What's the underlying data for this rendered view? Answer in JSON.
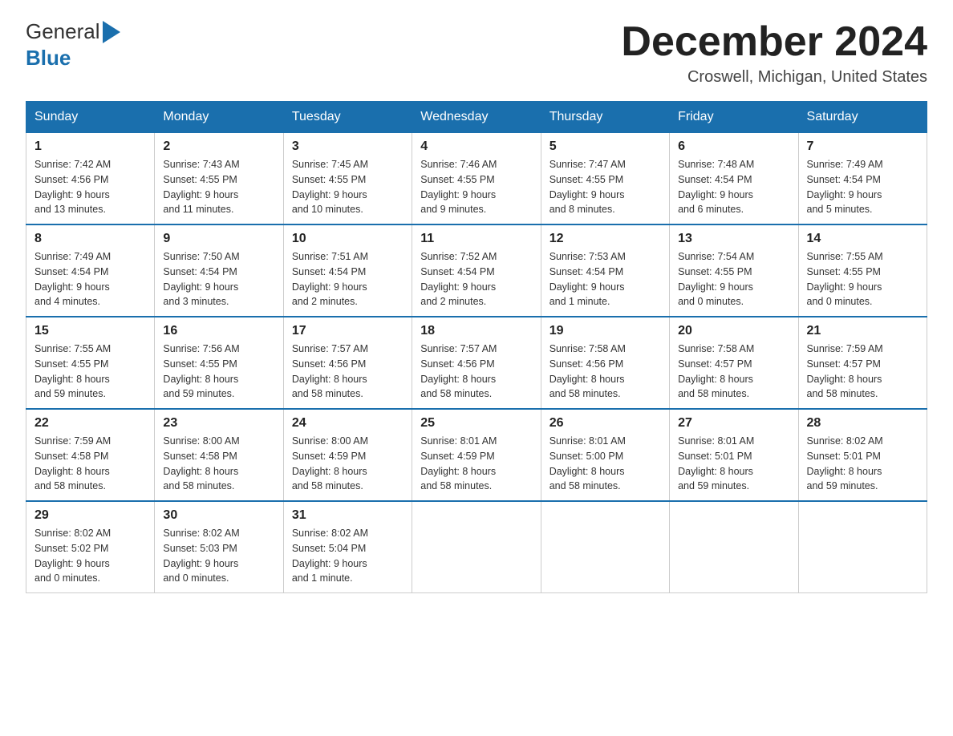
{
  "header": {
    "logo_general": "General",
    "logo_blue": "Blue",
    "title": "December 2024",
    "subtitle": "Croswell, Michigan, United States"
  },
  "weekdays": [
    "Sunday",
    "Monday",
    "Tuesday",
    "Wednesday",
    "Thursday",
    "Friday",
    "Saturday"
  ],
  "weeks": [
    [
      {
        "day": "1",
        "info": "Sunrise: 7:42 AM\nSunset: 4:56 PM\nDaylight: 9 hours\nand 13 minutes."
      },
      {
        "day": "2",
        "info": "Sunrise: 7:43 AM\nSunset: 4:55 PM\nDaylight: 9 hours\nand 11 minutes."
      },
      {
        "day": "3",
        "info": "Sunrise: 7:45 AM\nSunset: 4:55 PM\nDaylight: 9 hours\nand 10 minutes."
      },
      {
        "day": "4",
        "info": "Sunrise: 7:46 AM\nSunset: 4:55 PM\nDaylight: 9 hours\nand 9 minutes."
      },
      {
        "day": "5",
        "info": "Sunrise: 7:47 AM\nSunset: 4:55 PM\nDaylight: 9 hours\nand 8 minutes."
      },
      {
        "day": "6",
        "info": "Sunrise: 7:48 AM\nSunset: 4:54 PM\nDaylight: 9 hours\nand 6 minutes."
      },
      {
        "day": "7",
        "info": "Sunrise: 7:49 AM\nSunset: 4:54 PM\nDaylight: 9 hours\nand 5 minutes."
      }
    ],
    [
      {
        "day": "8",
        "info": "Sunrise: 7:49 AM\nSunset: 4:54 PM\nDaylight: 9 hours\nand 4 minutes."
      },
      {
        "day": "9",
        "info": "Sunrise: 7:50 AM\nSunset: 4:54 PM\nDaylight: 9 hours\nand 3 minutes."
      },
      {
        "day": "10",
        "info": "Sunrise: 7:51 AM\nSunset: 4:54 PM\nDaylight: 9 hours\nand 2 minutes."
      },
      {
        "day": "11",
        "info": "Sunrise: 7:52 AM\nSunset: 4:54 PM\nDaylight: 9 hours\nand 2 minutes."
      },
      {
        "day": "12",
        "info": "Sunrise: 7:53 AM\nSunset: 4:54 PM\nDaylight: 9 hours\nand 1 minute."
      },
      {
        "day": "13",
        "info": "Sunrise: 7:54 AM\nSunset: 4:55 PM\nDaylight: 9 hours\nand 0 minutes."
      },
      {
        "day": "14",
        "info": "Sunrise: 7:55 AM\nSunset: 4:55 PM\nDaylight: 9 hours\nand 0 minutes."
      }
    ],
    [
      {
        "day": "15",
        "info": "Sunrise: 7:55 AM\nSunset: 4:55 PM\nDaylight: 8 hours\nand 59 minutes."
      },
      {
        "day": "16",
        "info": "Sunrise: 7:56 AM\nSunset: 4:55 PM\nDaylight: 8 hours\nand 59 minutes."
      },
      {
        "day": "17",
        "info": "Sunrise: 7:57 AM\nSunset: 4:56 PM\nDaylight: 8 hours\nand 58 minutes."
      },
      {
        "day": "18",
        "info": "Sunrise: 7:57 AM\nSunset: 4:56 PM\nDaylight: 8 hours\nand 58 minutes."
      },
      {
        "day": "19",
        "info": "Sunrise: 7:58 AM\nSunset: 4:56 PM\nDaylight: 8 hours\nand 58 minutes."
      },
      {
        "day": "20",
        "info": "Sunrise: 7:58 AM\nSunset: 4:57 PM\nDaylight: 8 hours\nand 58 minutes."
      },
      {
        "day": "21",
        "info": "Sunrise: 7:59 AM\nSunset: 4:57 PM\nDaylight: 8 hours\nand 58 minutes."
      }
    ],
    [
      {
        "day": "22",
        "info": "Sunrise: 7:59 AM\nSunset: 4:58 PM\nDaylight: 8 hours\nand 58 minutes."
      },
      {
        "day": "23",
        "info": "Sunrise: 8:00 AM\nSunset: 4:58 PM\nDaylight: 8 hours\nand 58 minutes."
      },
      {
        "day": "24",
        "info": "Sunrise: 8:00 AM\nSunset: 4:59 PM\nDaylight: 8 hours\nand 58 minutes."
      },
      {
        "day": "25",
        "info": "Sunrise: 8:01 AM\nSunset: 4:59 PM\nDaylight: 8 hours\nand 58 minutes."
      },
      {
        "day": "26",
        "info": "Sunrise: 8:01 AM\nSunset: 5:00 PM\nDaylight: 8 hours\nand 58 minutes."
      },
      {
        "day": "27",
        "info": "Sunrise: 8:01 AM\nSunset: 5:01 PM\nDaylight: 8 hours\nand 59 minutes."
      },
      {
        "day": "28",
        "info": "Sunrise: 8:02 AM\nSunset: 5:01 PM\nDaylight: 8 hours\nand 59 minutes."
      }
    ],
    [
      {
        "day": "29",
        "info": "Sunrise: 8:02 AM\nSunset: 5:02 PM\nDaylight: 9 hours\nand 0 minutes."
      },
      {
        "day": "30",
        "info": "Sunrise: 8:02 AM\nSunset: 5:03 PM\nDaylight: 9 hours\nand 0 minutes."
      },
      {
        "day": "31",
        "info": "Sunrise: 8:02 AM\nSunset: 5:04 PM\nDaylight: 9 hours\nand 1 minute."
      },
      null,
      null,
      null,
      null
    ]
  ]
}
